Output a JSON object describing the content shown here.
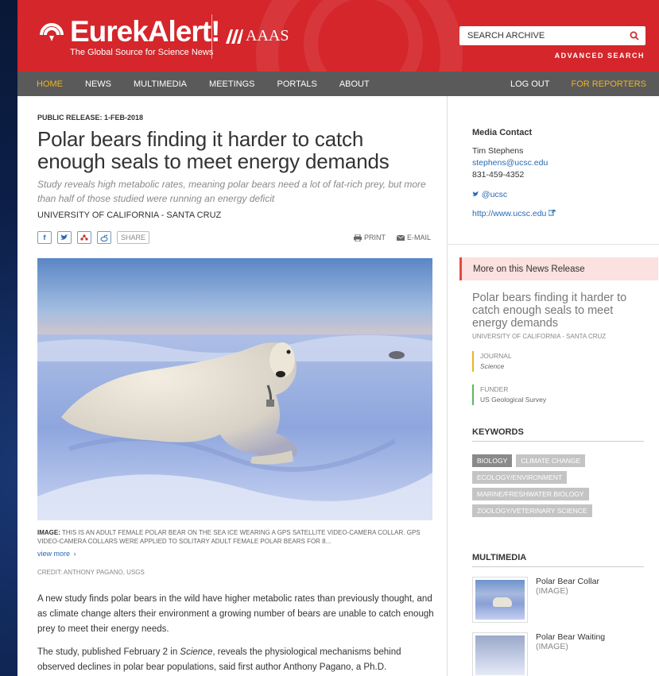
{
  "brand": {
    "logo_text": "EurekAlert!",
    "tagline": "The Global Source for Science News",
    "partner": "AAAS"
  },
  "search": {
    "placeholder": "SEARCH ARCHIVE",
    "advanced_label": "ADVANCED SEARCH"
  },
  "nav": {
    "items": [
      "HOME",
      "NEWS",
      "MULTIMEDIA",
      "MEETINGS",
      "PORTALS",
      "ABOUT"
    ],
    "logout": "LOG OUT",
    "reporters": "FOR REPORTERS"
  },
  "article": {
    "release_label": "PUBLIC RELEASE: 1-FEB-2018",
    "title": "Polar bears finding it harder to catch enough seals to meet energy demands",
    "subtitle": "Study reveals high metabolic rates, meaning polar bears need a lot of fat-rich prey, but more than half of those studied were running an energy deficit",
    "institution": "UNIVERSITY OF CALIFORNIA - SANTA CRUZ",
    "share_label": "SHARE",
    "print_label": "PRINT",
    "email_label": "E-MAIL",
    "caption_prefix": "IMAGE:",
    "caption": "THIS IS AN ADULT FEMALE POLAR BEAR ON THE SEA ICE WEARING A GPS SATELLITE VIDEO-CAMERA COLLAR. GPS VIDEO-CAMERA COLLARS WERE APPLIED TO SOLITARY ADULT FEMALE POLAR BEARS FOR 8...",
    "view_more": "view more",
    "credit": "CREDIT: ANTHONY PAGANO, USGS",
    "paragraph1": "A new study finds polar bears in the wild have higher metabolic rates than previously thought, and as climate change alters their environment a growing number of bears are unable to catch enough prey to meet their energy needs.",
    "paragraph2_a": "The study, published February 2 in ",
    "paragraph2_journal": "Science",
    "paragraph2_b": ", reveals the physiological mechanisms behind observed declines in polar bear populations, said first author Anthony Pagano, a Ph.D."
  },
  "sidebar": {
    "media_contact_title": "Media Contact",
    "contact_name": "Tim Stephens",
    "contact_email": "stephens@ucsc.edu",
    "contact_phone": "831-459-4352",
    "twitter": "@ucsc",
    "website": "http://www.ucsc.edu",
    "more_header": "More on this News Release",
    "more_title": "Polar bears finding it harder to catch enough seals to meet energy demands",
    "more_institution": "UNIVERSITY OF CALIFORNIA - SANTA CRUZ",
    "journal_label": "JOURNAL",
    "journal_value": "Science",
    "funder_label": "FUNDER",
    "funder_value": "US Geological Survey",
    "keywords_title": "KEYWORDS",
    "keywords": [
      "BIOLOGY",
      "CLIMATE CHANGE",
      "ECOLOGY/ENVIRONMENT",
      "MARINE/FRESHWATER BIOLOGY",
      "ZOOLOGY/VETERINARY SCIENCE"
    ],
    "multimedia_title": "MULTIMEDIA",
    "multimedia": [
      {
        "title": "Polar Bear Collar",
        "type": "(IMAGE)"
      },
      {
        "title": "Polar Bear Waiting",
        "type": "(IMAGE)"
      }
    ]
  },
  "colors": {
    "header_red": "#d4262b",
    "nav_gray": "#5a5a5a",
    "nav_active": "#f0b323",
    "link_blue": "#2a6ab1",
    "more_box_bg": "#fbe1df"
  }
}
